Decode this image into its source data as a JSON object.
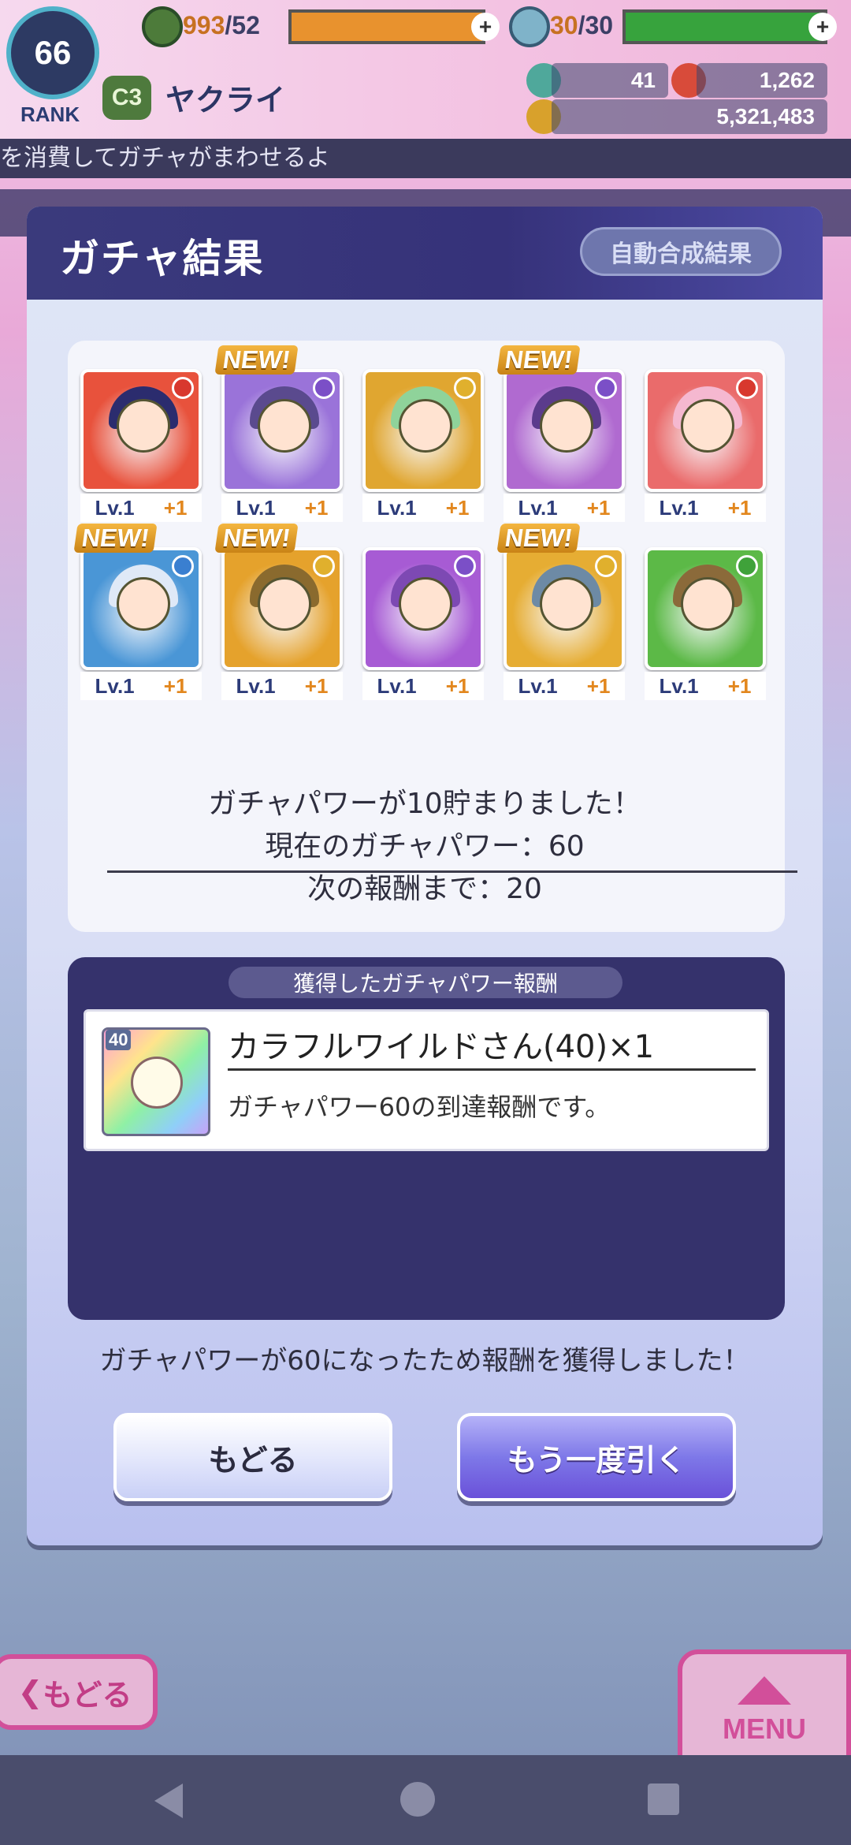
{
  "hud": {
    "rank_value": "66",
    "rank_label": "RANK",
    "badge": "C3",
    "player_name": "ヤクライ",
    "stamina_current": "993",
    "stamina_max": "/52",
    "potion_current": "30",
    "potion_max": "/30",
    "gems": "41",
    "tickets": "1,262",
    "coins": "5,321,483",
    "ticker_text": "を消費してガチャがまわせるよ"
  },
  "modal": {
    "title": "ガチャ結果",
    "auto_button": "自動合成結果"
  },
  "cards": [
    {
      "level": "Lv.1",
      "bonus": "+1",
      "new": "",
      "bg": "#e8523c",
      "hair": "#2b2c6e",
      "attr": "#d8382e"
    },
    {
      "level": "Lv.1",
      "bonus": "+1",
      "new": "NEW!",
      "bg": "#9a73d9",
      "hair": "#5a4a8e",
      "attr": "#7b4fc7"
    },
    {
      "level": "Lv.1",
      "bonus": "+1",
      "new": "",
      "bg": "#e0a630",
      "hair": "#8fd39a",
      "attr": "#e0b02d"
    },
    {
      "level": "Lv.1",
      "bonus": "+1",
      "new": "NEW!",
      "bg": "#b06ad0",
      "hair": "#5b3b8c",
      "attr": "#7b4fc7"
    },
    {
      "level": "Lv.1",
      "bonus": "+1",
      "new": "",
      "bg": "#ea6b6b",
      "hair": "#f5b8d0",
      "attr": "#d8382e"
    },
    {
      "level": "Lv.1",
      "bonus": "+1",
      "new": "NEW!",
      "bg": "#4a96d6",
      "hair": "#dfe9f7",
      "attr": "#3a7fd0"
    },
    {
      "level": "Lv.1",
      "bonus": "+1",
      "new": "NEW!",
      "bg": "#e5a22c",
      "hair": "#8a6a2e",
      "attr": "#e0b02d"
    },
    {
      "level": "Lv.1",
      "bonus": "+1",
      "new": "",
      "bg": "#a75bd4",
      "hair": "#7d49b3",
      "attr": "#7b4fc7"
    },
    {
      "level": "Lv.1",
      "bonus": "+1",
      "new": "NEW!",
      "bg": "#e6ad33",
      "hair": "#6d8aa5",
      "attr": "#e0b02d"
    },
    {
      "level": "Lv.1",
      "bonus": "+1",
      "new": "",
      "bg": "#5cb947",
      "hair": "#8b6a3a",
      "attr": "#3fa23a"
    }
  ],
  "power": {
    "line1": "ガチャパワーが10貯まりました！",
    "line2": "現在のガチャパワー：60",
    "line3": "次の報酬まで：20"
  },
  "reward": {
    "heading": "獲得したガチャパワー報酬",
    "icon_level": "40",
    "name": "カラフルワイルドさん(40)×1",
    "description": "ガチャパワー60の到達報酬です。"
  },
  "footer_message": "ガチャパワーが60になったため報酬を獲得しました！",
  "buttons": {
    "back": "もどる",
    "again": "もう一度引く"
  },
  "bottom_nav": {
    "back": "もどる",
    "menu": "MENU"
  },
  "colors": {
    "stamina_bar": "#e8922e",
    "potion_bar": "#37a33d",
    "modal_header": "#36327a",
    "again_button": "#6a51d9"
  }
}
